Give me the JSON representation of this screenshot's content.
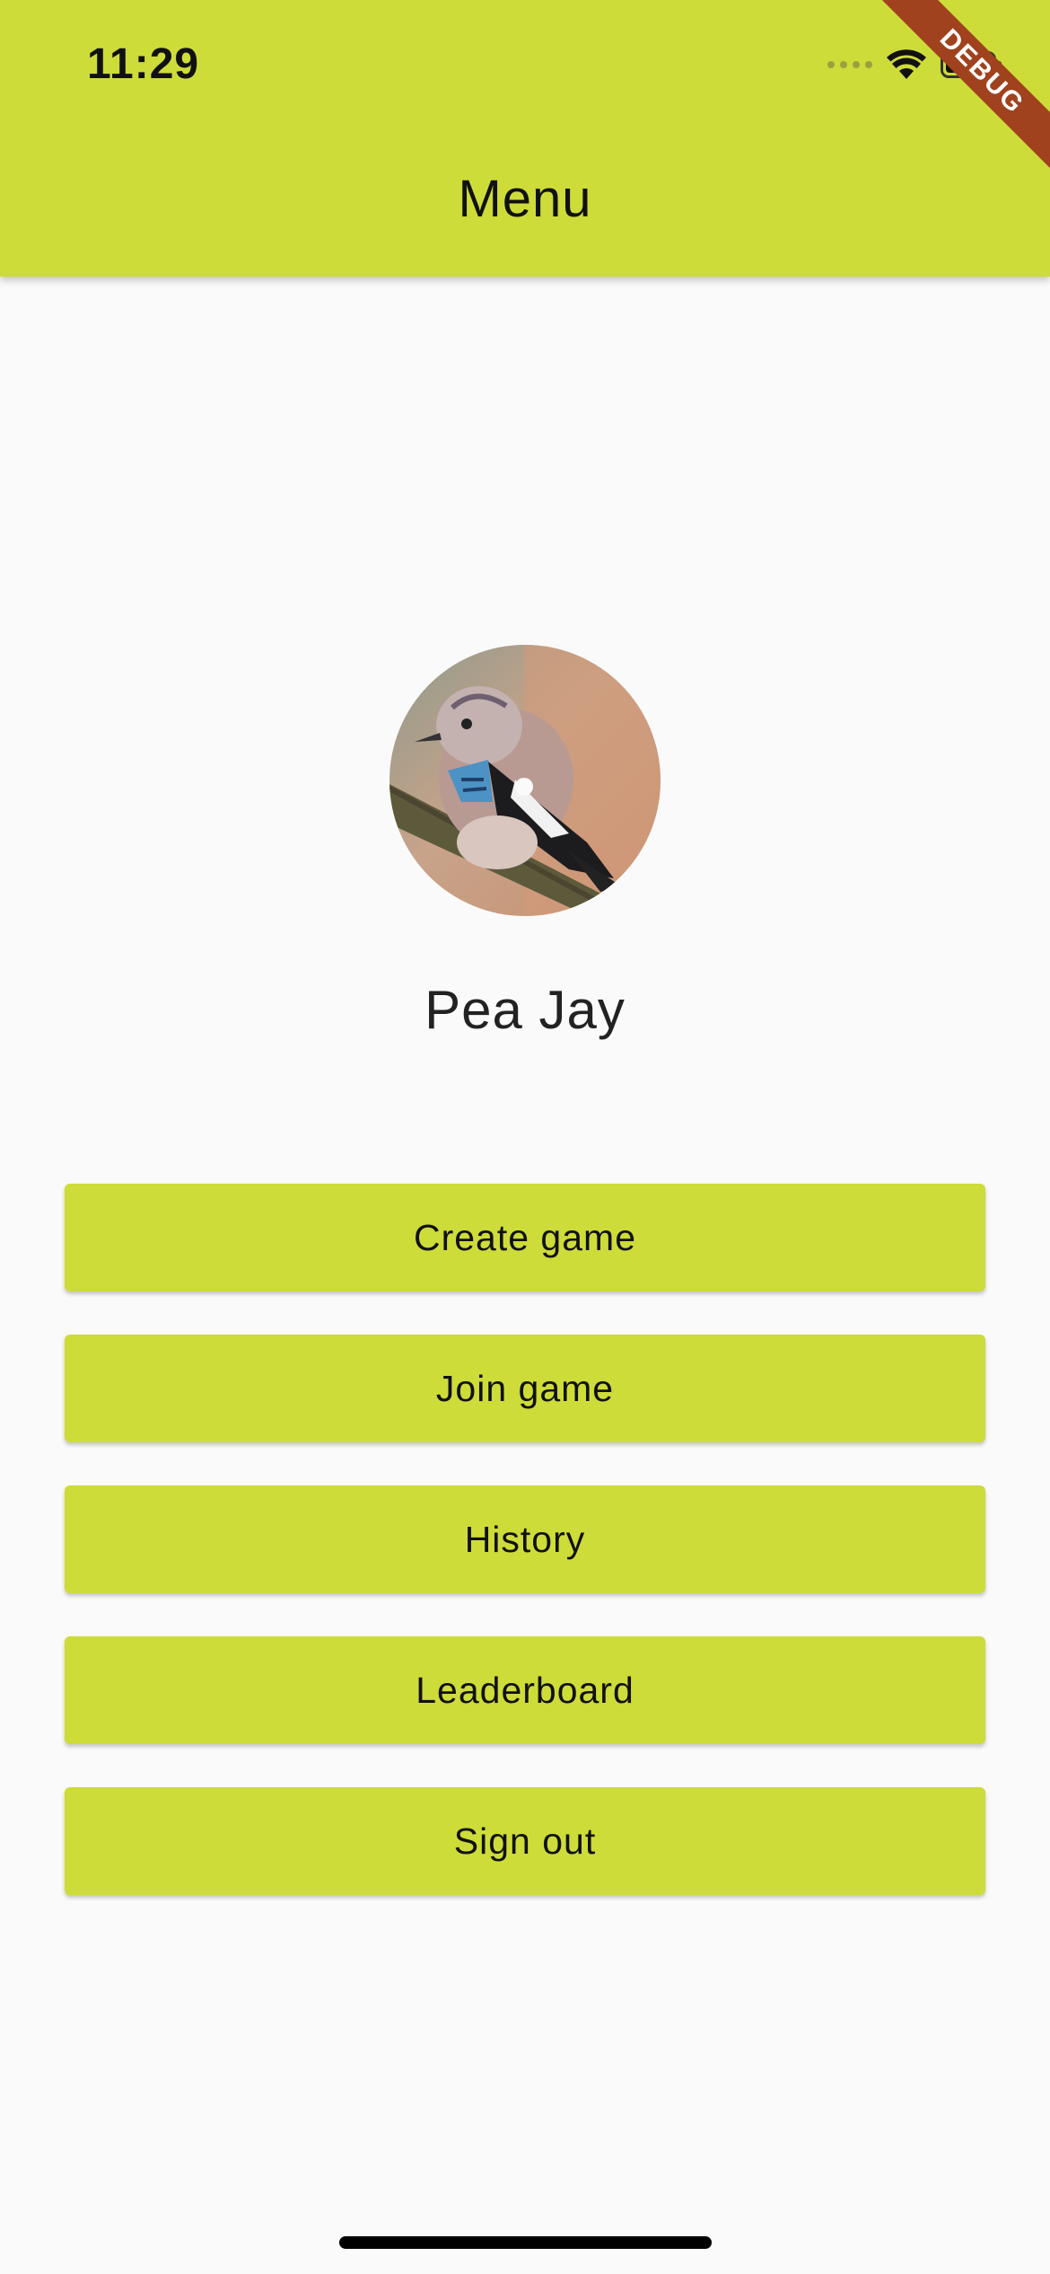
{
  "status_bar": {
    "time": "11:29",
    "icons": [
      "signal-icon",
      "wifi-icon",
      "battery-icon"
    ]
  },
  "debug_banner": "DEBUG",
  "app_bar": {
    "title": "Menu",
    "color": "#cddc39"
  },
  "profile": {
    "avatar_icon": "bird-avatar-icon",
    "name": "Pea Jay"
  },
  "menu": {
    "create_game": "Create game",
    "join_game": "Join game",
    "history": "History",
    "leaderboard": "Leaderboard",
    "sign_out": "Sign out"
  },
  "colors": {
    "accent": "#cddc39",
    "background": "#fafafa",
    "debug_ribbon": "#a0421e"
  }
}
